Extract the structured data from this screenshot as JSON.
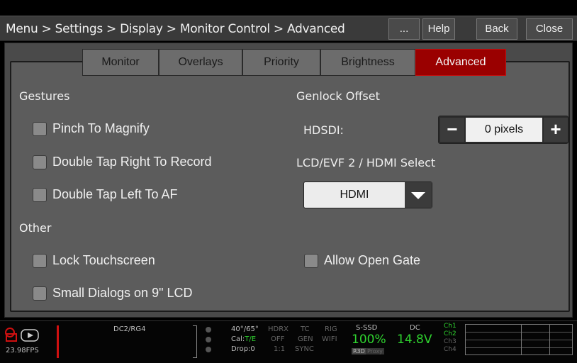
{
  "titlebar": {
    "breadcrumb": "Menu > Settings > Display > Monitor Control > Advanced",
    "more_label": "...",
    "help_label": "Help",
    "back_label": "Back",
    "close_label": "Close"
  },
  "tabs": [
    {
      "label": "Monitor",
      "active": false
    },
    {
      "label": "Overlays",
      "active": false
    },
    {
      "label": "Priority",
      "active": false
    },
    {
      "label": "Brightness",
      "active": false
    },
    {
      "label": "Advanced",
      "active": true
    }
  ],
  "gestures": {
    "heading": "Gestures",
    "options": [
      {
        "label": "Pinch To Magnify",
        "checked": false
      },
      {
        "label": "Double Tap Right To Record",
        "checked": false
      },
      {
        "label": "Double Tap Left To AF",
        "checked": false
      }
    ]
  },
  "other": {
    "heading": "Other",
    "options": [
      {
        "label": "Lock Touchscreen",
        "checked": false
      },
      {
        "label": "Small Dialogs on 9\" LCD",
        "checked": false
      },
      {
        "label": "Allow Open Gate",
        "checked": false
      }
    ]
  },
  "genlock": {
    "heading": "Genlock Offset",
    "hdsdi_label": "HDSDI:",
    "value": "0 pixels",
    "minus_icon": "minus-icon",
    "plus_icon": "plus-icon"
  },
  "lcd_select": {
    "heading": "LCD/EVF 2 / HDMI Select",
    "value": "HDMI"
  },
  "status_bar": {
    "fps": "23.98FPS",
    "look": "DC2/RG4",
    "temp": "40°/65°",
    "cal_prefix": "Cal:",
    "cal_value": "T/E",
    "drop": "Drop:0",
    "hdrx": "HDRX",
    "off": "OFF",
    "ratio": "1:1",
    "tc": "TC",
    "gen": "GEN",
    "sync": "SYNC",
    "rig": "RIG",
    "wifi": "WIFI",
    "media_label": "S-SSD",
    "media_value": "100%",
    "r3d": "R3D",
    "proxy": "Proxy",
    "power_label": "DC",
    "power_value": "14.8V",
    "channels": [
      "Ch1",
      "Ch2",
      "Ch3",
      "Ch4"
    ],
    "colors": {
      "green": "#2fd32f",
      "red": "#d01010",
      "tab_active": "#9a0000"
    }
  }
}
